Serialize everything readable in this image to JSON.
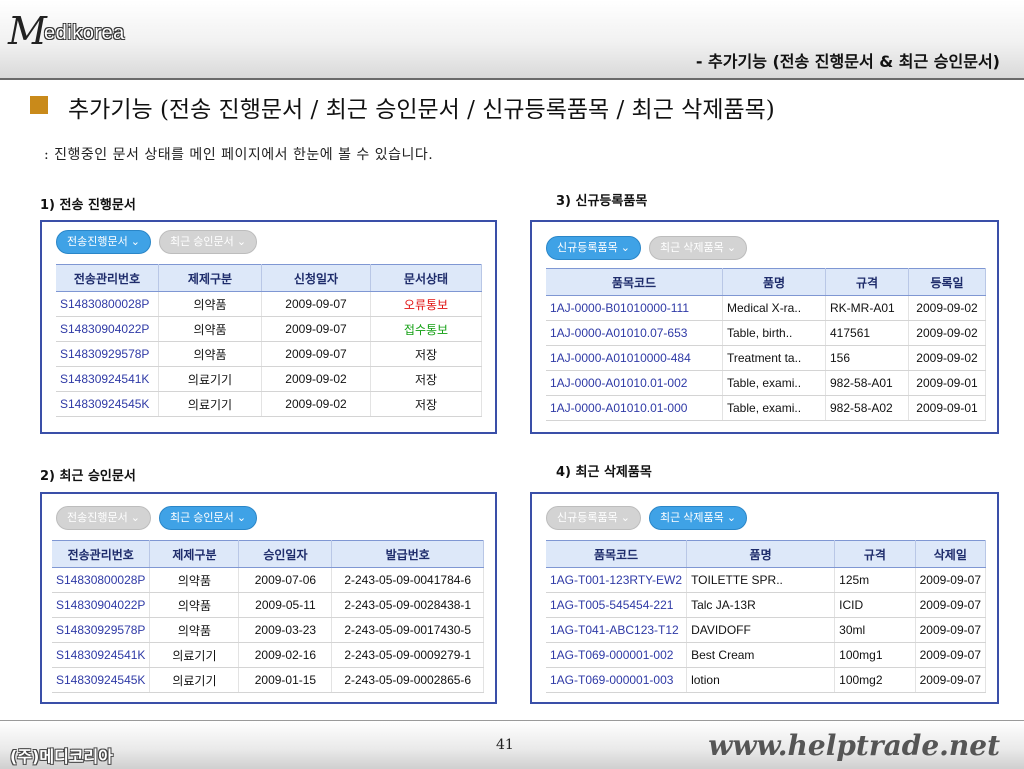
{
  "header": {
    "logo_m": "M",
    "logo_rest": "edikorea",
    "title": "-  추가기능 (전송 진행문서 & 최근 승인문서)"
  },
  "main_title": "추가기능 (전송 진행문서 / 최근 승인문서 / 신규등록품목 / 최근 삭제품목)",
  "subtext": ": 진행중인 문서 상태를 메인 페이지에서 한눈에 볼 수 있습니다.",
  "colors": {
    "accent_bullet": "#c98a1a",
    "panel_border": "#3a4fa8",
    "tab_active": "#3fa2e6",
    "link": "#2f3aa6"
  },
  "sections": {
    "s1": {
      "label": "1) 전송 진행문서",
      "tab_active": "전송진행문서 ⌄",
      "tab_inactive": "최근 승인문서 ⌄",
      "columns": [
        "전송관리번호",
        "제제구분",
        "신청일자",
        "문서상태"
      ],
      "rows": [
        [
          "S14830800028P",
          "의약품",
          "2009-09-07",
          "오류통보"
        ],
        [
          "S14830904022P",
          "의약품",
          "2009-09-07",
          "접수통보"
        ],
        [
          "S14830929578P",
          "의약품",
          "2009-09-07",
          "저장"
        ],
        [
          "S14830924541K",
          "의료기기",
          "2009-09-02",
          "저장"
        ],
        [
          "S14830924545K",
          "의료기기",
          "2009-09-02",
          "저장"
        ]
      ]
    },
    "s2": {
      "label": "2) 최근 승인문서",
      "tab_inactive": "전송진행문서 ⌄",
      "tab_active": "최근 승인문서 ⌄",
      "columns": [
        "전송관리번호",
        "제제구분",
        "승인일자",
        "발급번호"
      ],
      "rows": [
        [
          "S14830800028P",
          "의약품",
          "2009-07-06",
          "2-243-05-09-0041784-6"
        ],
        [
          "S14830904022P",
          "의약품",
          "2009-05-11",
          "2-243-05-09-0028438-1"
        ],
        [
          "S14830929578P",
          "의약품",
          "2009-03-23",
          "2-243-05-09-0017430-5"
        ],
        [
          "S14830924541K",
          "의료기기",
          "2009-02-16",
          "2-243-05-09-0009279-1"
        ],
        [
          "S14830924545K",
          "의료기기",
          "2009-01-15",
          "2-243-05-09-0002865-6"
        ]
      ]
    },
    "s3": {
      "label": "3) 신규등록품목",
      "tab_active": "신규등록품목 ⌄",
      "tab_inactive": "최근 삭제품목 ⌄",
      "columns": [
        "품목코드",
        "품명",
        "규격",
        "등록일"
      ],
      "rows": [
        [
          "1AJ-0000-B01010000-111",
          "Medical X-ra..",
          "RK-MR-A01",
          "2009-09-02"
        ],
        [
          "1AJ-0000-A01010.07-653",
          "Table, birth..",
          "417561",
          "2009-09-02"
        ],
        [
          "1AJ-0000-A01010000-484",
          "Treatment ta..",
          "156",
          "2009-09-02"
        ],
        [
          "1AJ-0000-A01010.01-002",
          "Table, exami..",
          "982-58-A01",
          "2009-09-01"
        ],
        [
          "1AJ-0000-A01010.01-000",
          "Table, exami..",
          "982-58-A02",
          "2009-09-01"
        ]
      ]
    },
    "s4": {
      "label": "4) 최근 삭제품목",
      "tab_inactive": "신규등록품목 ⌄",
      "tab_active": "최근 삭제품목 ⌄",
      "columns": [
        "품목코드",
        "품명",
        "규격",
        "삭제일"
      ],
      "rows": [
        [
          "1AG-T001-123RTY-EW2",
          "TOILETTE SPR..",
          "125m",
          "2009-09-07"
        ],
        [
          "1AG-T005-545454-221",
          "Talc JA-13R",
          "ICID",
          "2009-09-07"
        ],
        [
          "1AG-T041-ABC123-T12",
          "DAVIDOFF",
          "30ml",
          "2009-09-07"
        ],
        [
          "1AG-T069-000001-002",
          "Best Cream",
          "100mg1",
          "2009-09-07"
        ],
        [
          "1AG-T069-000001-003",
          "lotion",
          "100mg2",
          "2009-09-07"
        ]
      ]
    }
  },
  "footer": {
    "brand": "(주)메디코리아",
    "page": "41",
    "url": "www.helptrade.net"
  }
}
